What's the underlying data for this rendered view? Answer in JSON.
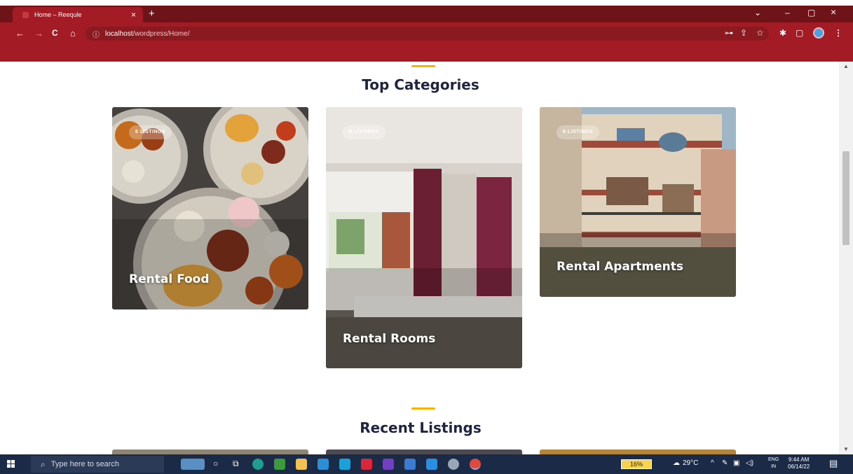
{
  "browser": {
    "tab_title": "Home – Reequle",
    "tab_close": "×",
    "new_tab": "+",
    "url_host": "localhost",
    "url_path": "/wordpress/Home/"
  },
  "icons": {
    "back": "←",
    "forward": "→",
    "reload": "C",
    "home": "⌂",
    "info": "ⓘ",
    "key": "⊶",
    "share": "⇪",
    "star": "☆",
    "extensions": "✱",
    "sidebar": "▢",
    "menu": "⋮",
    "minimize": "–",
    "restore": "▢",
    "close": "×",
    "chevron": "⌄"
  },
  "sections": {
    "top_categories": {
      "title": "Top Categories"
    },
    "recent_listings": {
      "title": "Recent Listings"
    }
  },
  "categories": [
    {
      "name": "Rental Food",
      "badge": "6 LISTINGS"
    },
    {
      "name": "Rental Rooms",
      "badge": "8 LISTINGS"
    },
    {
      "name": "Rental Apartments",
      "badge": "6 LISTINGS"
    }
  ],
  "taskbar": {
    "search_placeholder": "Type here to search",
    "battery": "16%",
    "temperature": "29°C",
    "lang_top": "ENG",
    "lang_bottom": "IN",
    "time": "9:44 AM",
    "date": "06/14/22"
  },
  "colors": {
    "chrome_dark": "#6e1418",
    "chrome_red": "#a31c25",
    "accent": "#f5b400",
    "heading": "#1f2540",
    "taskbar": "#1b2a46"
  }
}
